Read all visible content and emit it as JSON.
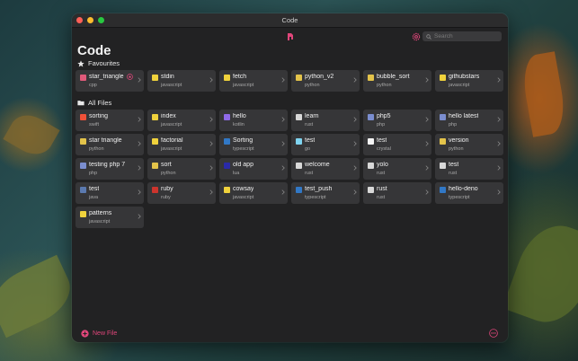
{
  "window": {
    "title": "Code"
  },
  "toolbar": {
    "search_placeholder": "Search"
  },
  "page_title": "Code",
  "favourites": {
    "heading": "Favourites",
    "items": [
      {
        "name": "star_triangle",
        "lang": "cpp",
        "icon": "cpp",
        "favorite": true
      },
      {
        "name": "stdin",
        "lang": "javascript",
        "icon": "javascript"
      },
      {
        "name": "fetch",
        "lang": "javascript",
        "icon": "javascript"
      },
      {
        "name": "python_v2",
        "lang": "python",
        "icon": "python"
      },
      {
        "name": "bubble_sort",
        "lang": "python",
        "icon": "python"
      },
      {
        "name": "githubstars",
        "lang": "javascript",
        "icon": "javascript"
      }
    ]
  },
  "all_files": {
    "heading": "All Files",
    "items": [
      {
        "name": "sorting",
        "lang": "swift",
        "icon": "swift"
      },
      {
        "name": "index",
        "lang": "javascript",
        "icon": "javascript"
      },
      {
        "name": "hello",
        "lang": "kotlin",
        "icon": "kotlin"
      },
      {
        "name": "learn",
        "lang": "rust",
        "icon": "rust"
      },
      {
        "name": "php5",
        "lang": "php",
        "icon": "php"
      },
      {
        "name": "hello latest",
        "lang": "php",
        "icon": "php"
      },
      {
        "name": "star triangle",
        "lang": "python",
        "icon": "python"
      },
      {
        "name": "factorial",
        "lang": "javascript",
        "icon": "javascript"
      },
      {
        "name": "Sorting",
        "lang": "typescript",
        "icon": "typescript"
      },
      {
        "name": "test",
        "lang": "go",
        "icon": "go"
      },
      {
        "name": "test",
        "lang": "crystal",
        "icon": "crystal"
      },
      {
        "name": "version",
        "lang": "python",
        "icon": "python"
      },
      {
        "name": "testing php 7",
        "lang": "php",
        "icon": "php"
      },
      {
        "name": "sort",
        "lang": "python",
        "icon": "python"
      },
      {
        "name": "old app",
        "lang": "lua",
        "icon": "lua"
      },
      {
        "name": "welcome",
        "lang": "rust",
        "icon": "rust"
      },
      {
        "name": "yolo",
        "lang": "rust",
        "icon": "rust"
      },
      {
        "name": "test",
        "lang": "rust",
        "icon": "rust"
      },
      {
        "name": "test",
        "lang": "java",
        "icon": "java"
      },
      {
        "name": "ruby",
        "lang": "ruby",
        "icon": "ruby"
      },
      {
        "name": "cowsay",
        "lang": "javascript",
        "icon": "javascript"
      },
      {
        "name": "test_push",
        "lang": "typescript",
        "icon": "typescript"
      },
      {
        "name": "rust",
        "lang": "rust",
        "icon": "rust"
      },
      {
        "name": "hello-deno",
        "lang": "typescript",
        "icon": "typescript"
      },
      {
        "name": "patterns",
        "lang": "javascript",
        "icon": "javascript"
      }
    ]
  },
  "footer": {
    "new_file_label": "New File"
  },
  "colors": {
    "accent": "#e0467a",
    "card_bg": "#363638",
    "window_bg": "#222223",
    "lang": {
      "cpp": "#e05a7a",
      "javascript": "#f0d23c",
      "python": "#e3c34a",
      "swift": "#f05138",
      "kotlin": "#8f6ae8",
      "rust": "#d8d8d8",
      "php": "#7b8ed0",
      "typescript": "#3178c6",
      "go": "#7fd4f0",
      "crystal": "#f4f4f4",
      "lua": "#2a2aa8",
      "java": "#5b7ab0",
      "ruby": "#cc342d"
    }
  }
}
